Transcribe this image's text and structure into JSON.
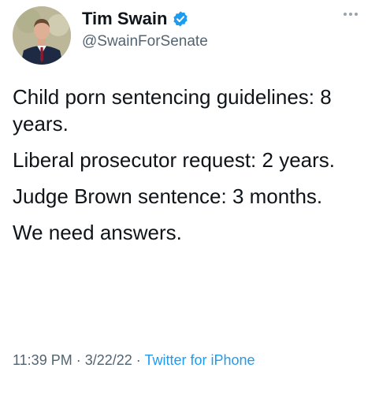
{
  "author": {
    "display_name": "Tim Swain",
    "handle": "@SwainForSenate",
    "verified": true
  },
  "tweet": {
    "paragraphs": [
      "Child porn sentencing guidelines: 8 years.",
      "Liberal prosecutor request: 2 years.",
      "Judge Brown sentence: 3 months.",
      "We need answers."
    ]
  },
  "meta": {
    "time": "11:39 PM",
    "separator": " · ",
    "date": "3/22/22",
    "source": "Twitter for iPhone"
  },
  "colors": {
    "text": "#0f1419",
    "secondary": "#536471",
    "accent": "#1d9bf0"
  },
  "icons": {
    "verified": "verified-badge-icon",
    "more": "more-options-icon"
  }
}
